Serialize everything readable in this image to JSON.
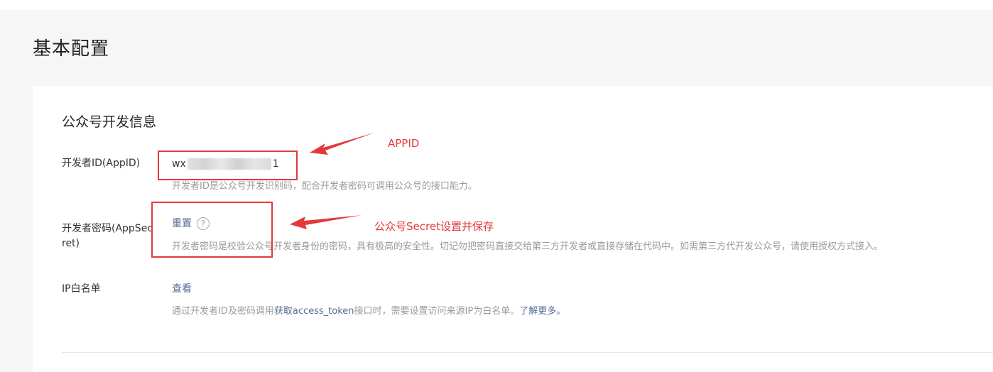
{
  "page": {
    "title": "基本配置"
  },
  "section": {
    "title": "公众号开发信息"
  },
  "appid": {
    "label": "开发者ID(AppID)",
    "value_prefix": "wx",
    "value_suffix": "1",
    "description": "开发者ID是公众号开发识别码，配合开发者密码可调用公众号的接口能力。"
  },
  "secret": {
    "label": "开发者密码(AppSecret)",
    "reset_label": "重置",
    "help_glyph": "?",
    "description": "开发者密码是校验公众号开发者身份的密码，具有极高的安全性。切记勿把密码直接交给第三方开发者或直接存储在代码中。如需第三方代开发公众号，请使用授权方式接入。"
  },
  "ip_whitelist": {
    "label": "IP白名单",
    "view_label": "查看",
    "desc_part1": "通过开发者ID及密码调用",
    "desc_link1": "获取access_token",
    "desc_part2": "接口时，需要设置访问来源IP为白名单。",
    "desc_link2": "了解更多。"
  },
  "annotations": {
    "appid_label": "APPID",
    "secret_label": "公众号Secret设置并保存",
    "color": "#e5383b"
  },
  "colors": {
    "link": "#576b95",
    "muted": "#9a9a9a",
    "background": "#f6f6f6"
  }
}
